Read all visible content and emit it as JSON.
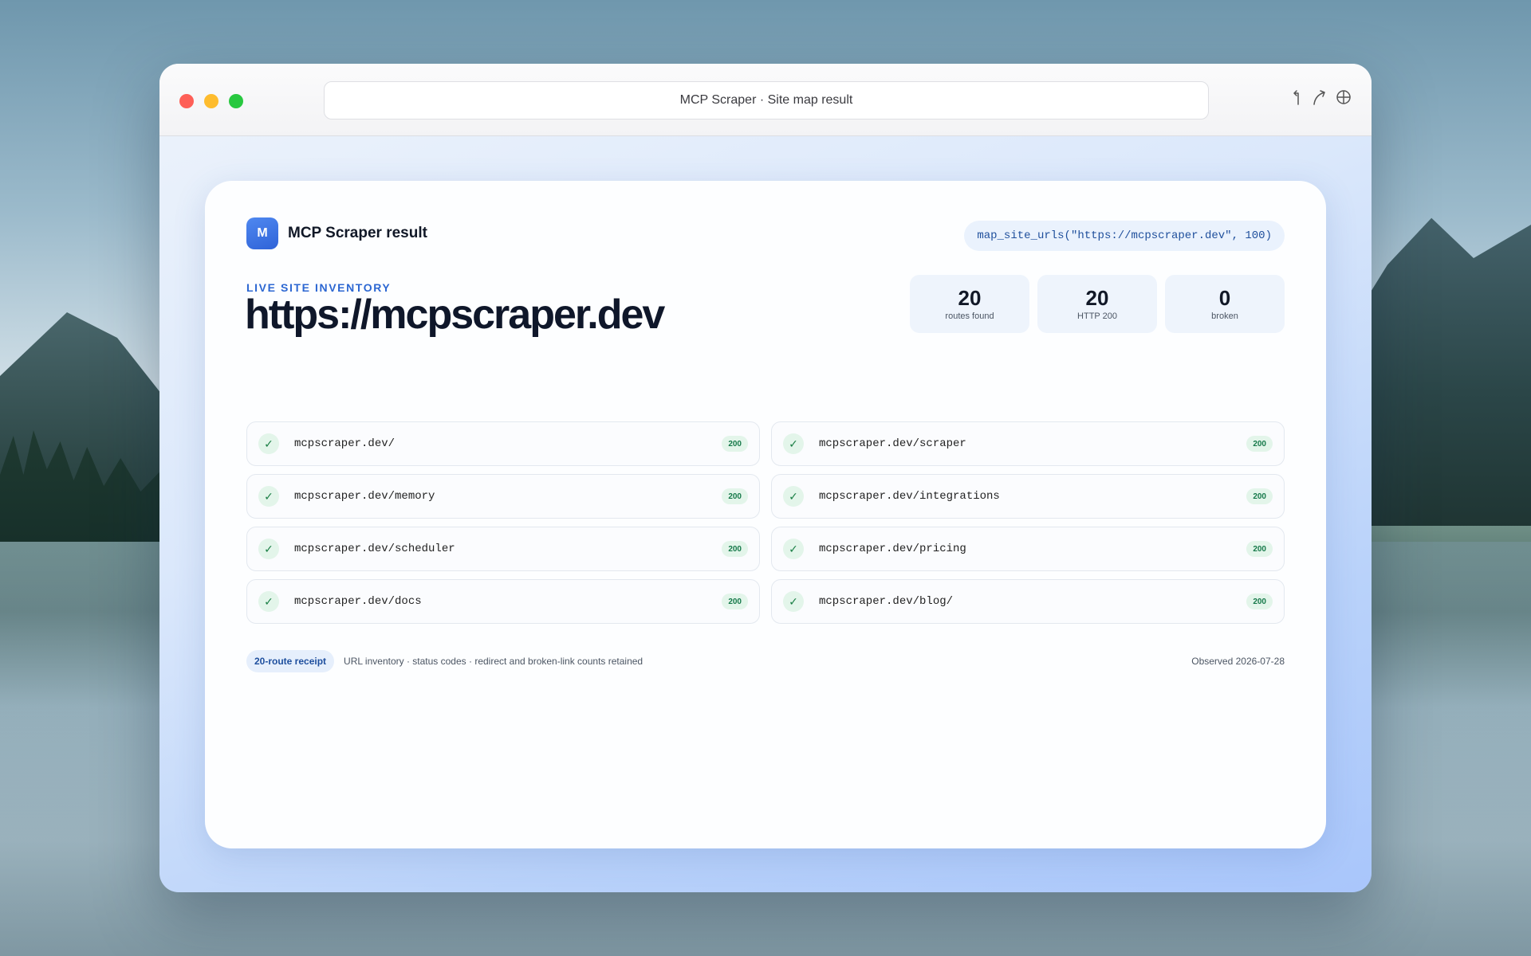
{
  "window": {
    "title": "MCP Scraper · Site map result"
  },
  "toolbar": {
    "icons": [
      "back-arrow-icon",
      "share-arrow-icon",
      "globe-icon"
    ]
  },
  "card": {
    "logo_letter": "M",
    "app_name": "MCP Scraper result",
    "call": "map_site_urls(\"https://mcpscraper.dev\", 100)",
    "eyebrow": "LIVE SITE INVENTORY",
    "site_url": "https://mcpscraper.dev",
    "stats": [
      {
        "value": "20",
        "label": "routes found"
      },
      {
        "value": "20",
        "label": "HTTP 200"
      },
      {
        "value": "0",
        "label": "broken"
      }
    ],
    "routes": [
      {
        "url": "mcpscraper.dev/",
        "status": "200"
      },
      {
        "url": "mcpscraper.dev/scraper",
        "status": "200"
      },
      {
        "url": "mcpscraper.dev/memory",
        "status": "200"
      },
      {
        "url": "mcpscraper.dev/integrations",
        "status": "200"
      },
      {
        "url": "mcpscraper.dev/scheduler",
        "status": "200"
      },
      {
        "url": "mcpscraper.dev/pricing",
        "status": "200"
      },
      {
        "url": "mcpscraper.dev/docs",
        "status": "200"
      },
      {
        "url": "mcpscraper.dev/blog/",
        "status": "200"
      }
    ],
    "check_glyph": "✓",
    "footer": {
      "receipt": "20-route receipt",
      "note": "URL inventory · status codes · redirect and broken-link counts retained",
      "observed": "Observed 2026-07-28"
    }
  },
  "colors": {
    "accent": "#2c67d2",
    "success": "#16794a",
    "traffic_red": "#fe5f57",
    "traffic_yellow": "#febc2e",
    "traffic_green": "#28c840"
  }
}
